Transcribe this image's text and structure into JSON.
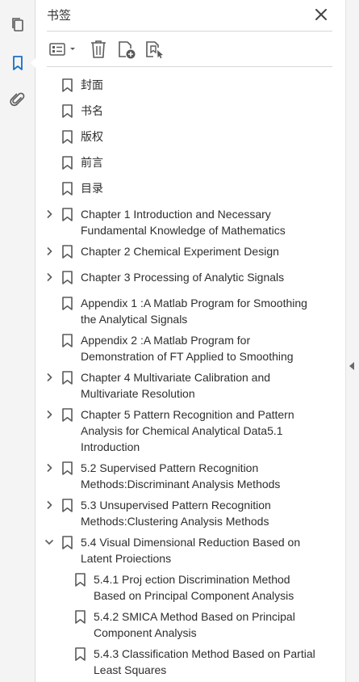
{
  "panel": {
    "title": "书签"
  },
  "icons": {
    "rail": [
      "pages-icon",
      "bookmark-icon",
      "attachment-icon"
    ],
    "toolbar": [
      "options-menu-icon",
      "delete-icon",
      "new-bookmark-icon",
      "bookmark-settings-icon"
    ],
    "close": "close-icon"
  },
  "colors": {
    "accent": "#1a6fc4",
    "icon": "#5a5a5a",
    "text": "#2e2e2e"
  },
  "bookmarks": [
    {
      "lines": [
        "封面"
      ],
      "expandable": false,
      "expanded": false,
      "level": 0
    },
    {
      "lines": [
        "书名"
      ],
      "expandable": false,
      "expanded": false,
      "level": 0
    },
    {
      "lines": [
        "版权"
      ],
      "expandable": false,
      "expanded": false,
      "level": 0
    },
    {
      "lines": [
        "前言"
      ],
      "expandable": false,
      "expanded": false,
      "level": 0
    },
    {
      "lines": [
        "目录"
      ],
      "expandable": false,
      "expanded": false,
      "level": 0
    },
    {
      "lines": [
        "Chapter 1 Introduction and Necessary",
        "Fundamental Knowledge of Mathematics"
      ],
      "expandable": true,
      "expanded": false,
      "level": 0
    },
    {
      "lines": [
        "Chapter 2 Chemical Experiment Design"
      ],
      "expandable": true,
      "expanded": false,
      "level": 0
    },
    {
      "lines": [
        "Chapter 3 Processing of Analytic Signals"
      ],
      "expandable": true,
      "expanded": false,
      "level": 0
    },
    {
      "lines": [
        "Appendix 1 :A Matlab Program for Smoothing",
        "the Analytical Signals"
      ],
      "expandable": false,
      "expanded": false,
      "level": 0
    },
    {
      "lines": [
        "Appendix 2 :A Matlab Program for",
        "Demonstration of FT Applied to Smoothing"
      ],
      "expandable": false,
      "expanded": false,
      "level": 0
    },
    {
      "lines": [
        "Chapter 4 Multivariate Calibration and",
        "Multivariate Resolution"
      ],
      "expandable": true,
      "expanded": false,
      "level": 0
    },
    {
      "lines": [
        "Chapter 5 Pattern Recognition and Pattern",
        "Analysis for Chemical Analytical Data5.1",
        "Introduction"
      ],
      "expandable": true,
      "expanded": false,
      "level": 0
    },
    {
      "lines": [
        "5.2 Supervised Pattern Recognition",
        "Methods:Discriminant Analysis Methods"
      ],
      "expandable": true,
      "expanded": false,
      "level": 0
    },
    {
      "lines": [
        "5.3 Unsupervised Pattern Recognition",
        "Methods:Clustering Analysis Methods"
      ],
      "expandable": true,
      "expanded": false,
      "level": 0
    },
    {
      "lines": [
        "5.4 Visual Dimensional Reduction Based on",
        "Latent Proiections"
      ],
      "expandable": true,
      "expanded": true,
      "level": 0
    },
    {
      "lines": [
        "5.4.1 Proj ection Discrimination Method",
        "Based on Principal Component Analysis"
      ],
      "expandable": false,
      "expanded": false,
      "level": 1
    },
    {
      "lines": [
        "5.4.2 SMICA Method Based on Principal",
        "Component Analysis"
      ],
      "expandable": false,
      "expanded": false,
      "level": 1
    },
    {
      "lines": [
        "5.4.3 Classification Method Based on Partial",
        "Least Squares"
      ],
      "expandable": false,
      "expanded": false,
      "level": 1
    }
  ]
}
